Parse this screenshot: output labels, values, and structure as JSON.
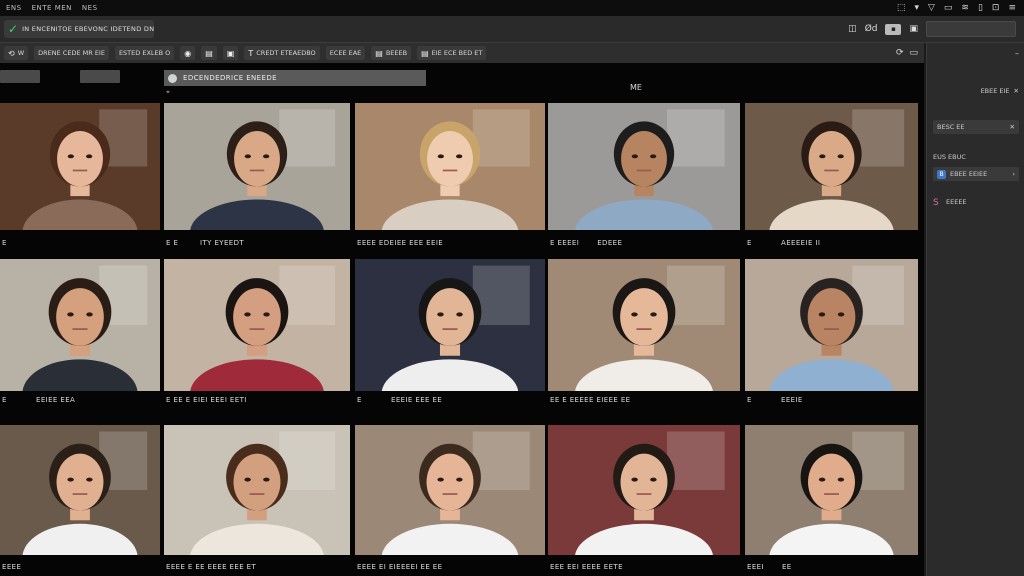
{
  "menu": [
    "ENS",
    "ENTE MEN",
    "NES"
  ],
  "titlebar": {
    "tab_title": "IN ENCENITOE EBEVONC IDETEND DNTD",
    "right_label": "Ød"
  },
  "toolbar": {
    "buttons": [
      {
        "icon": "⟲",
        "label": "W"
      },
      {
        "icon": "",
        "label": "DRENE CEDE MR EIE"
      },
      {
        "icon": "",
        "label": "ESTED EXLEB O"
      },
      {
        "icon": "◉",
        "label": ""
      },
      {
        "icon": "▤",
        "label": ""
      },
      {
        "icon": "▣",
        "label": ""
      },
      {
        "icon": "T",
        "label": "CREDT ETEAEDBO"
      },
      {
        "icon": "",
        "label": "ECEE EAE"
      },
      {
        "icon": "▤",
        "label": "BEEEB"
      },
      {
        "icon": "▤",
        "label": "EIE ECE BED ET"
      }
    ]
  },
  "right_panel": {
    "items": [
      "EBEE EIE",
      "BESC EE",
      "EUS EBUC",
      "EBEE EEIEE"
    ]
  },
  "main": {
    "name_bar": "EDCENDEDRICE ENEEDE",
    "me_label": "ME"
  },
  "tiles": [
    {
      "bg": "#5a3a28",
      "skin": "#e6b79a",
      "hair": "#4a2a1a",
      "shirt": "#8a6a58",
      "caption": [
        "E",
        ""
      ]
    },
    {
      "bg": "#a9a49a",
      "skin": "#d9a886",
      "hair": "#2b1f17",
      "shirt": "#2c3446",
      "caption": [
        "E E",
        "ITY EYEEDT"
      ]
    },
    {
      "bg": "#a8876a",
      "skin": "#efcbb0",
      "hair": "#c8a46a",
      "shirt": "#d8cfc2",
      "caption": [
        "EEEE EDEIEE EEE EEIE",
        ""
      ]
    },
    {
      "bg": "#9b9a98",
      "skin": "#b78462",
      "hair": "#1d1d1d",
      "shirt": "#8ea9c4",
      "caption": [
        "E EEEEI",
        "EDEEE"
      ]
    },
    {
      "bg": "#6e5a48",
      "skin": "#d9a988",
      "hair": "#2a1c14",
      "shirt": "#e6d8c6",
      "caption": [
        "E",
        "AEEEEIE II"
      ]
    },
    {
      "bg": "#b8b2a6",
      "skin": "#d4a07e",
      "hair": "#2a1d15",
      "shirt": "#2a2e36",
      "caption": [
        "E",
        "EEIEE EEA"
      ]
    },
    {
      "bg": "#c2b3a2",
      "skin": "#d49f80",
      "hair": "#1a1412",
      "shirt": "#9e2a3a",
      "caption": [
        "E EE E EIEI EEEI EETI",
        ""
      ]
    },
    {
      "bg": "#2c3040",
      "skin": "#e2b596",
      "hair": "#161616",
      "shirt": "#eeeeee",
      "caption": [
        "E",
        "EEEIE EEE EE"
      ]
    },
    {
      "bg": "#a08a76",
      "skin": "#e6b89a",
      "hair": "#1b1714",
      "shirt": "#f0ede8",
      "caption": [
        "EE E EEEEE EIEEE EE",
        ""
      ]
    },
    {
      "bg": "#b7a899",
      "skin": "#b98463",
      "hair": "#282220",
      "shirt": "#8fb0d0",
      "caption": [
        "E",
        "EEEIE"
      ]
    },
    {
      "bg": "#6a5a4c",
      "skin": "#e0b090",
      "hair": "#2b2017",
      "shirt": "#f0f0f0",
      "caption": [
        "EEEE",
        ""
      ]
    },
    {
      "bg": "#c9c2b6",
      "skin": "#d3a07f",
      "hair": "#4a2c1c",
      "shirt": "#ece6dc",
      "caption": [
        "EEEE E EE EEEE EEE ET",
        ""
      ]
    },
    {
      "bg": "#9b8877",
      "skin": "#e6b598",
      "hair": "#3b2a1e",
      "shirt": "#f2f2f2",
      "caption": [
        "EEEE EI EIEEEEI EE EE",
        ""
      ]
    },
    {
      "bg": "#7a3a3a",
      "skin": "#e2b597",
      "hair": "#221a15",
      "shirt": "#f2f2f2",
      "caption": [
        "EEE EEI EEEE EETE",
        ""
      ]
    },
    {
      "bg": "#8e7f70",
      "skin": "#e0ac8c",
      "hair": "#171412",
      "shirt": "#f4f4f4",
      "caption": [
        "EEEI",
        "EE"
      ]
    }
  ]
}
